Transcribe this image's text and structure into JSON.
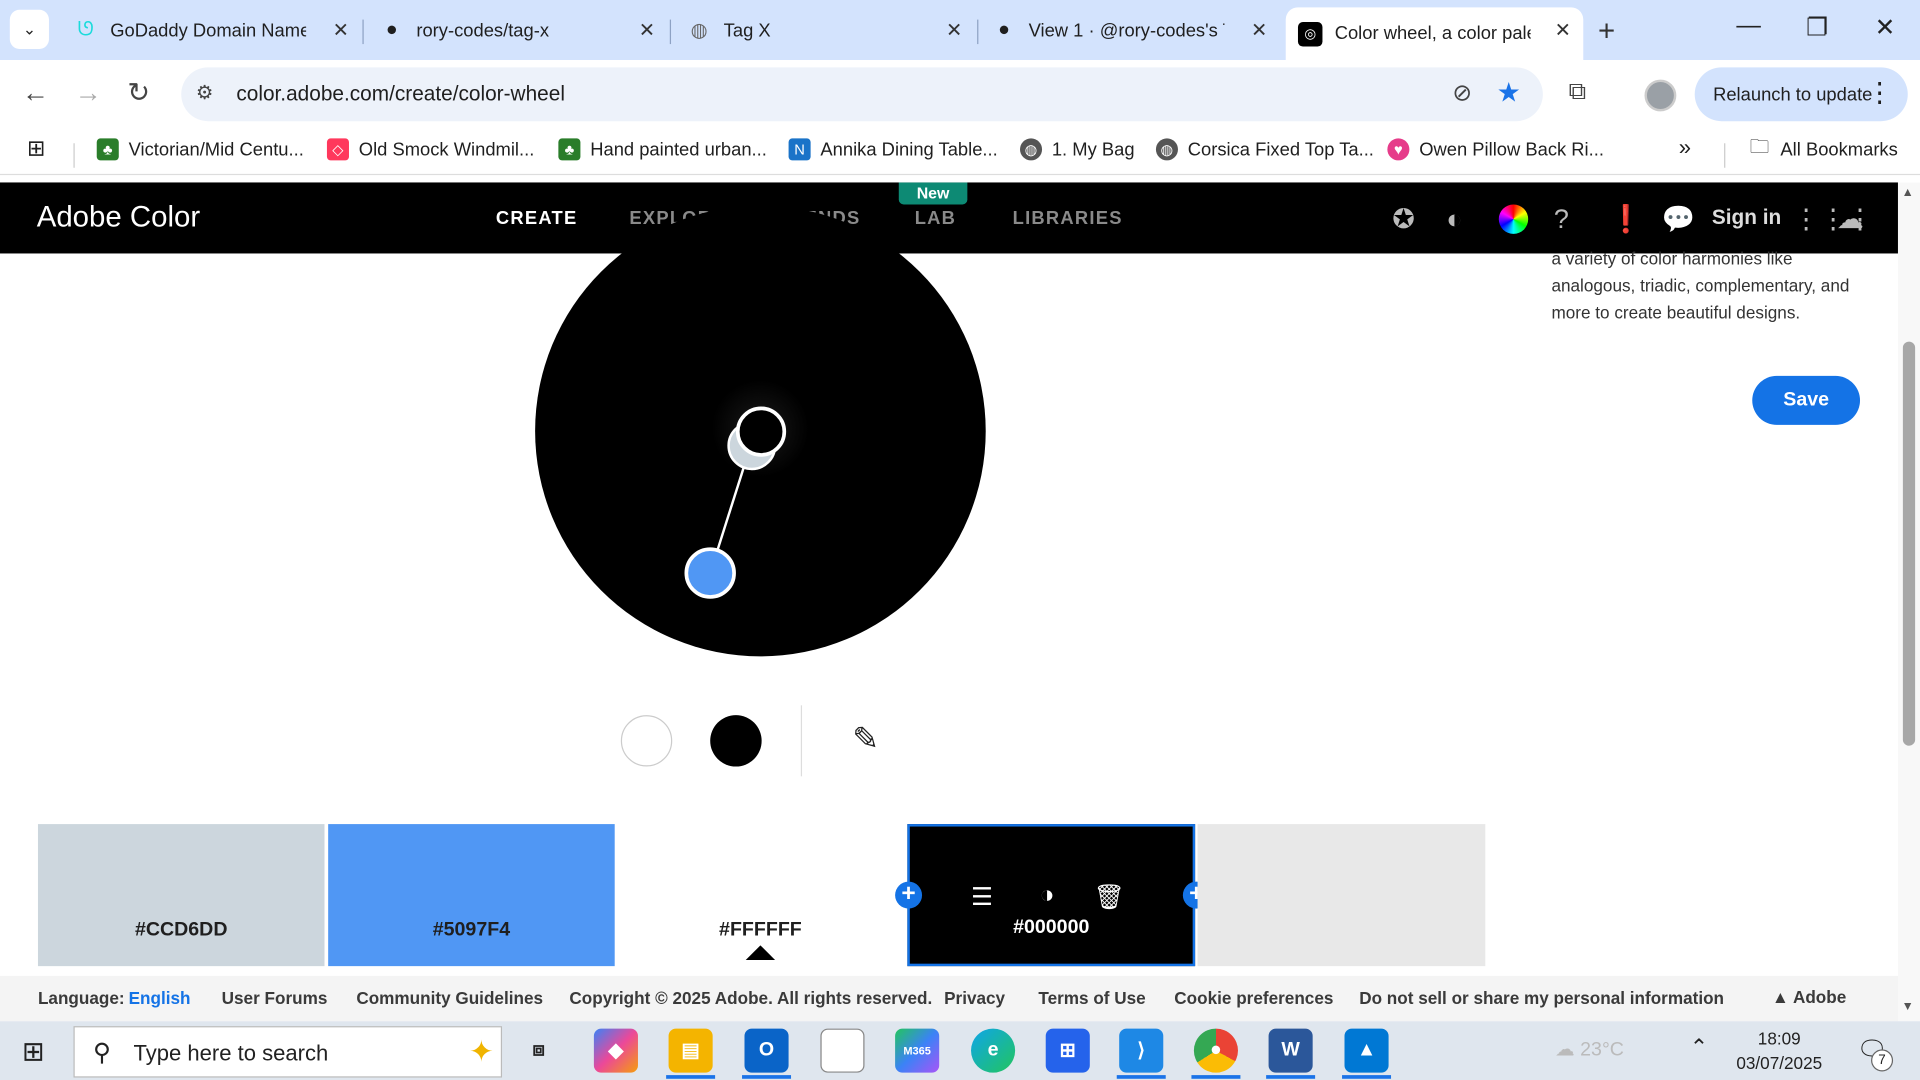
{
  "browser": {
    "tabs": [
      {
        "title": "GoDaddy Domain Name",
        "icon": "godaddy-icon"
      },
      {
        "title": "rory-codes/tag-x",
        "icon": "github-icon"
      },
      {
        "title": "Tag X",
        "icon": "globe-icon"
      },
      {
        "title": "View 1 · @rory-codes's T/",
        "icon": "github-icon"
      },
      {
        "title": "Color wheel, a color palet",
        "icon": "adobe-color-icon",
        "active": true
      }
    ],
    "url": "color.adobe.com/create/color-wheel",
    "relaunch_label": "Relaunch to update",
    "bookmarks": [
      "Victorian/Mid Centu...",
      "Old Smock Windmil...",
      "Hand painted urban...",
      "Annika Dining Table...",
      "1. My Bag",
      "Corsica Fixed Top Ta...",
      "Owen Pillow Back Ri..."
    ],
    "all_bookmarks_label": "All Bookmarks"
  },
  "header": {
    "brand": "Adobe Color",
    "nav": [
      "CREATE",
      "EXPLORE",
      "TRENDS",
      "LAB",
      "LIBRARIES"
    ],
    "active_nav": "CREATE",
    "new_badge": "New",
    "sign_in": "Sign in"
  },
  "main": {
    "side_text": "a variety of color harmonies like analogous, triadic, complementary, and more to create beautiful designs.",
    "save_label": "Save",
    "handle_colors": {
      "base": "#000000",
      "secondary": "#CCD6DD",
      "selected": "#5097F4"
    }
  },
  "swatches": [
    {
      "hex": "#CCD6DD",
      "color": "#CCD6DD"
    },
    {
      "hex": "#5097F4",
      "color": "#5097F4"
    },
    {
      "hex": "#FFFFFF",
      "color": "#FFFFFF"
    },
    {
      "hex": "#000000",
      "color": "#000000"
    },
    {
      "hex": "",
      "color": "#E8E8E8"
    }
  ],
  "footer": {
    "language_label": "Language:",
    "language_value": "English",
    "links": [
      "User Forums",
      "Community Guidelines",
      "Copyright © 2025 Adobe. All rights reserved.",
      "Privacy",
      "Terms of Use",
      "Cookie preferences",
      "Do not sell or share my personal information"
    ],
    "adobe": "Adobe"
  },
  "taskbar": {
    "search_placeholder": "Type here to search",
    "weather": "23°C",
    "time": "18:09",
    "date": "03/07/2025",
    "notification_count": "7"
  }
}
